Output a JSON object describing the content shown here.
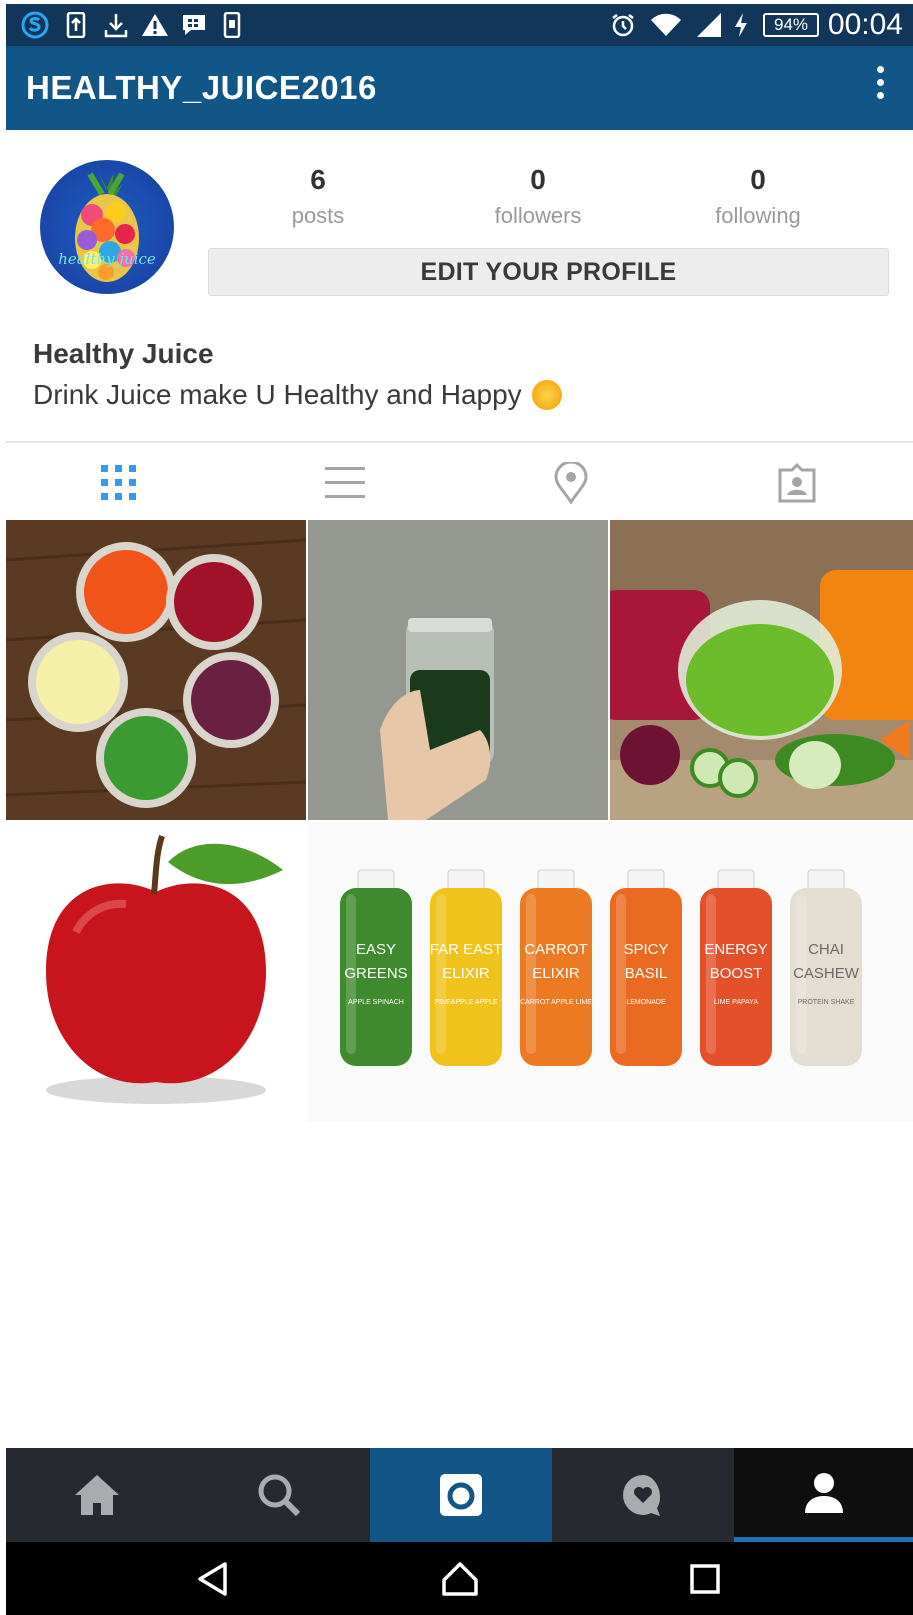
{
  "status_bar": {
    "battery": "94%",
    "time": "00:04",
    "icons": [
      "skype-icon",
      "upload-icon",
      "download-icon",
      "warning-icon",
      "bbm-icon",
      "phone-icon",
      "alarm-icon",
      "wifi-icon",
      "signal-icon",
      "charging-icon"
    ]
  },
  "app_bar": {
    "title": "HEALTHY_JUICE2016",
    "menu_icon": "more-vertical-icon"
  },
  "profile": {
    "avatar_text": "healthy juice",
    "stats": [
      {
        "value": "6",
        "label": "posts"
      },
      {
        "value": "0",
        "label": "followers"
      },
      {
        "value": "0",
        "label": "following"
      }
    ],
    "edit_button": "EDIT YOUR PROFILE",
    "name": "Healthy Juice",
    "bio": "Drink Juice make U Healthy and Happy",
    "bio_emoji": "sun-emoji"
  },
  "view_tabs": [
    {
      "icon": "grid-icon",
      "active": true
    },
    {
      "icon": "list-icon",
      "active": false
    },
    {
      "icon": "location-pin-icon",
      "active": false
    },
    {
      "icon": "tagged-photos-icon",
      "active": false
    }
  ],
  "posts": [
    {
      "subject": "juice glasses on wood"
    },
    {
      "subject": "hand holding green juice jar"
    },
    {
      "subject": "juices with beetroot and cucumber"
    },
    {
      "subject": "red apple"
    },
    {
      "subject": "bottled juices"
    }
  ],
  "bottles": [
    {
      "l1": "EASY",
      "l2": "GREENS",
      "l3": "APPLE SPINACH",
      "color": "#3f8a2e"
    },
    {
      "l1": "FAR EAST",
      "l2": "ELIXIR",
      "l3": "PINEAPPLE APPLE",
      "color": "#f0c21c"
    },
    {
      "l1": "CARROT",
      "l2": "ELIXIR",
      "l3": "CARROT APPLE LIME",
      "color": "#ec7a22"
    },
    {
      "l1": "SPICY",
      "l2": "BASIL",
      "l3": "LEMONADE",
      "color": "#ea6a22"
    },
    {
      "l1": "ENERGY",
      "l2": "BOOST",
      "l3": "LIME PAPAYA",
      "color": "#e4502a"
    },
    {
      "l1": "CHAI",
      "l2": "CASHEW",
      "l3": "PROTEIN SHAKE",
      "color": "#e4ddd2"
    }
  ],
  "bottom_nav": [
    "home-icon",
    "search-icon",
    "camera-icon",
    "activity-icon",
    "profile-icon"
  ],
  "android_nav": [
    "back-icon",
    "home-circle-icon",
    "recents-icon"
  ],
  "colors": {
    "status_bar": "#12365a",
    "app_bar": "#125688",
    "accent_blue": "#3897f0",
    "bottom_nav": "#262a30",
    "active_tab_bar": "#1f72b8"
  }
}
